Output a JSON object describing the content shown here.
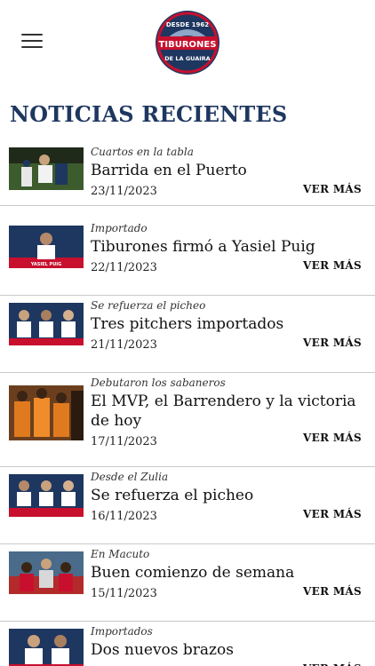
{
  "brand": {
    "logo_text": "TIBURONES",
    "logo_top": "DESDE 1962",
    "logo_bottom": "DE LA GUAIRA"
  },
  "section_title": "NOTICIAS RECIENTES",
  "more_label": "VER MÁS",
  "news": [
    {
      "kicker": "Cuartos en la tabla",
      "title": "Barrida en el Puerto",
      "date": "23/11/2023"
    },
    {
      "kicker": "Importado",
      "title": "Tiburones firmó a Yasiel Puig",
      "date": "22/11/2023",
      "thumb_caption": "YASIEL PUIG"
    },
    {
      "kicker": "Se refuerza el picheo",
      "title": "Tres pitchers importados",
      "date": "21/11/2023"
    },
    {
      "kicker": "Debutaron los sabaneros",
      "title": "El MVP, el Barrendero y la victoria de hoy",
      "date": "17/11/2023"
    },
    {
      "kicker": "Desde el Zulia",
      "title": "Se refuerza el picheo",
      "date": "16/11/2023"
    },
    {
      "kicker": "En Macuto",
      "title": "Buen comienzo de semana",
      "date": "15/11/2023"
    },
    {
      "kicker": "Importados",
      "title": "Dos nuevos brazos",
      "date": ""
    }
  ]
}
